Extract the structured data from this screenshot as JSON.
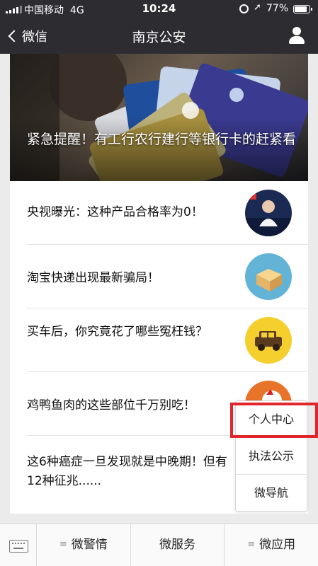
{
  "status_bar": {
    "carrier": "中国移动",
    "network": "4G",
    "time": "10:24",
    "battery_percent": "77%",
    "battery_level": 0.77
  },
  "navbar": {
    "back_label": "微信",
    "title": "南京公安"
  },
  "hero": {
    "caption": "紧急提醒！有工行农行建行等银行卡的赶紧看"
  },
  "articles": [
    {
      "title": "央视曝光：这种产品合格率为0！",
      "thumb_icon": "news-anchor-thumbnail"
    },
    {
      "title": "淘宝快递出现最新骗局！",
      "thumb_icon": "parcel-box-thumbnail"
    },
    {
      "title": "买车后，你究竟花了哪些冤枉钱？",
      "thumb_icon": "car-thumbnail"
    },
    {
      "title": "鸡鸭鱼肉的这些部位千万别吃！",
      "thumb_icon": "food-thumbnail"
    },
    {
      "title": "这6种癌症一旦发现就是中晚期！但有12种征兆......"
    }
  ],
  "popup_menu": {
    "items": [
      "个人中心",
      "执法公示",
      "微导航"
    ]
  },
  "bottom_menu": {
    "items": [
      "微警情",
      "微服务",
      "微应用"
    ]
  }
}
